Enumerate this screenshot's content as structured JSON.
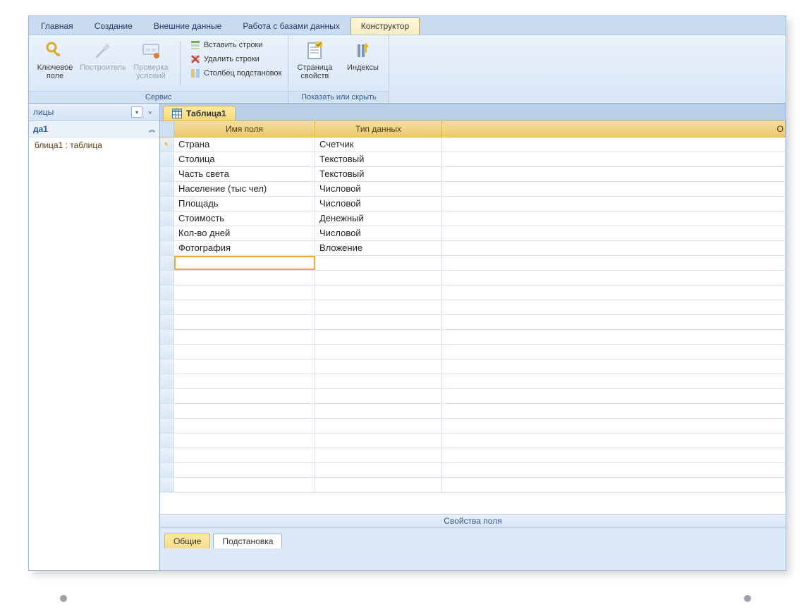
{
  "ribbon": {
    "tabs": [
      "Главная",
      "Создание",
      "Внешние данные",
      "Работа с базами данных",
      "Конструктор"
    ],
    "activeTabIndex": 4,
    "group_service_label": "Сервис",
    "group_show_label": "Показать или скрыть",
    "primary_key_label": "Ключевое поле",
    "builder_label": "Построитель",
    "validation_label1": "Проверка",
    "validation_label2": "условий",
    "insert_rows": "Вставить строки",
    "delete_rows": "Удалить строки",
    "lookup_column": "Столбец подстановок",
    "property_page_label1": "Страница",
    "property_page_label2": "свойств",
    "indexes_label": "Индексы"
  },
  "nav": {
    "category_label": "лицы",
    "group_title": "да1",
    "item_text": "блица1 : таблица"
  },
  "doc": {
    "tab_label": "Таблица1",
    "col_name": "Имя поля",
    "col_type": "Тип данных",
    "col_desc": "О",
    "rows": [
      {
        "name": "Страна",
        "type": "Счетчик",
        "pk": true
      },
      {
        "name": "Столица",
        "type": "Текстовый",
        "pk": false
      },
      {
        "name": "Часть света",
        "type": "Текстовый",
        "pk": false
      },
      {
        "name": "Население (тыс чел)",
        "type": "Числовой",
        "pk": false
      },
      {
        "name": "Площадь",
        "type": "Числовой",
        "pk": false
      },
      {
        "name": "Стоимость",
        "type": "Денежный",
        "pk": false
      },
      {
        "name": "Кол-во дней",
        "type": "Числовой",
        "pk": false
      },
      {
        "name": "Фотография",
        "type": "Вложение",
        "pk": false
      }
    ],
    "empty_rows": 15
  },
  "props": {
    "banner": "Свойства поля",
    "tab_general": "Общие",
    "tab_lookup": "Подстановка"
  }
}
